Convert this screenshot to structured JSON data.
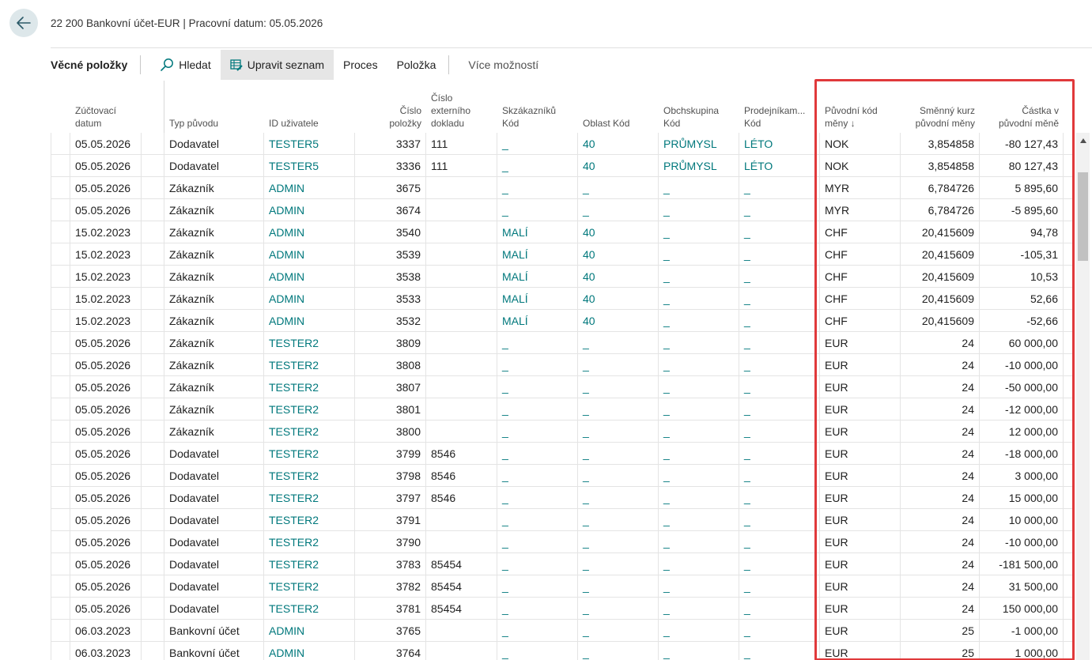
{
  "header": {
    "title": "22 200 Bankovní účet-EUR | Pracovní datum: 05.05.2026"
  },
  "action_bar": {
    "heading": "Věcné položky",
    "search": "Hledat",
    "edit_list": "Upravit seznam",
    "process": "Proces",
    "item": "Položka",
    "more": "Více možností"
  },
  "columns": {
    "posting_date": [
      "Zúčtovací",
      "datum"
    ],
    "source_type": [
      "Typ původu"
    ],
    "user_id": [
      "ID uživatele"
    ],
    "entry_no": [
      "Číslo",
      "položky"
    ],
    "ext_doc": [
      "Číslo",
      "externího",
      "dokladu"
    ],
    "cust_group": [
      "Skzákazníků",
      "Kód"
    ],
    "area_code": [
      "Oblast Kód"
    ],
    "bus_group": [
      "Obchskupina",
      "Kód"
    ],
    "salesperson": [
      "Prodejníkam...",
      "Kód"
    ],
    "orig_currency": [
      "Původní kód",
      "měny ↓"
    ],
    "exch_rate": [
      "Směnný kurz",
      "původní měny"
    ],
    "orig_amount": [
      "Částka v",
      "původní měně"
    ]
  },
  "rows": [
    {
      "date": "05.05.2026",
      "type": "Dodavatel",
      "user": "TESTER5",
      "no": "3337",
      "ext": "111",
      "cg": "_",
      "area": "40",
      "bg": "PRŮMYSL",
      "sp": "LÉTO",
      "cur": "NOK",
      "rate": "3,854858",
      "amt": "-80 127,43"
    },
    {
      "date": "05.05.2026",
      "type": "Dodavatel",
      "user": "TESTER5",
      "no": "3336",
      "ext": "111",
      "cg": "_",
      "area": "40",
      "bg": "PRŮMYSL",
      "sp": "LÉTO",
      "cur": "NOK",
      "rate": "3,854858",
      "amt": "80 127,43"
    },
    {
      "date": "05.05.2026",
      "type": "Zákazník",
      "user": "ADMIN",
      "no": "3675",
      "ext": "",
      "cg": "_",
      "area": "_",
      "bg": "_",
      "sp": "_",
      "cur": "MYR",
      "rate": "6,784726",
      "amt": "5 895,60"
    },
    {
      "date": "05.05.2026",
      "type": "Zákazník",
      "user": "ADMIN",
      "no": "3674",
      "ext": "",
      "cg": "_",
      "area": "_",
      "bg": "_",
      "sp": "_",
      "cur": "MYR",
      "rate": "6,784726",
      "amt": "-5 895,60"
    },
    {
      "date": "15.02.2023",
      "type": "Zákazník",
      "user": "ADMIN",
      "no": "3540",
      "ext": "",
      "cg": "MALÍ",
      "area": "40",
      "bg": "_",
      "sp": "_",
      "cur": "CHF",
      "rate": "20,415609",
      "amt": "94,78"
    },
    {
      "date": "15.02.2023",
      "type": "Zákazník",
      "user": "ADMIN",
      "no": "3539",
      "ext": "",
      "cg": "MALÍ",
      "area": "40",
      "bg": "_",
      "sp": "_",
      "cur": "CHF",
      "rate": "20,415609",
      "amt": "-105,31"
    },
    {
      "date": "15.02.2023",
      "type": "Zákazník",
      "user": "ADMIN",
      "no": "3538",
      "ext": "",
      "cg": "MALÍ",
      "area": "40",
      "bg": "_",
      "sp": "_",
      "cur": "CHF",
      "rate": "20,415609",
      "amt": "10,53"
    },
    {
      "date": "15.02.2023",
      "type": "Zákazník",
      "user": "ADMIN",
      "no": "3533",
      "ext": "",
      "cg": "MALÍ",
      "area": "40",
      "bg": "_",
      "sp": "_",
      "cur": "CHF",
      "rate": "20,415609",
      "amt": "52,66"
    },
    {
      "date": "15.02.2023",
      "type": "Zákazník",
      "user": "ADMIN",
      "no": "3532",
      "ext": "",
      "cg": "MALÍ",
      "area": "40",
      "bg": "_",
      "sp": "_",
      "cur": "CHF",
      "rate": "20,415609",
      "amt": "-52,66"
    },
    {
      "date": "05.05.2026",
      "type": "Zákazník",
      "user": "TESTER2",
      "no": "3809",
      "ext": "",
      "cg": "_",
      "area": "_",
      "bg": "_",
      "sp": "_",
      "cur": "EUR",
      "rate": "24",
      "amt": "60 000,00"
    },
    {
      "date": "05.05.2026",
      "type": "Zákazník",
      "user": "TESTER2",
      "no": "3808",
      "ext": "",
      "cg": "_",
      "area": "_",
      "bg": "_",
      "sp": "_",
      "cur": "EUR",
      "rate": "24",
      "amt": "-10 000,00"
    },
    {
      "date": "05.05.2026",
      "type": "Zákazník",
      "user": "TESTER2",
      "no": "3807",
      "ext": "",
      "cg": "_",
      "area": "_",
      "bg": "_",
      "sp": "_",
      "cur": "EUR",
      "rate": "24",
      "amt": "-50 000,00"
    },
    {
      "date": "05.05.2026",
      "type": "Zákazník",
      "user": "TESTER2",
      "no": "3801",
      "ext": "",
      "cg": "_",
      "area": "_",
      "bg": "_",
      "sp": "_",
      "cur": "EUR",
      "rate": "24",
      "amt": "-12 000,00"
    },
    {
      "date": "05.05.2026",
      "type": "Zákazník",
      "user": "TESTER2",
      "no": "3800",
      "ext": "",
      "cg": "_",
      "area": "_",
      "bg": "_",
      "sp": "_",
      "cur": "EUR",
      "rate": "24",
      "amt": "12 000,00"
    },
    {
      "date": "05.05.2026",
      "type": "Dodavatel",
      "user": "TESTER2",
      "no": "3799",
      "ext": "8546",
      "cg": "_",
      "area": "_",
      "bg": "_",
      "sp": "_",
      "cur": "EUR",
      "rate": "24",
      "amt": "-18 000,00"
    },
    {
      "date": "05.05.2026",
      "type": "Dodavatel",
      "user": "TESTER2",
      "no": "3798",
      "ext": "8546",
      "cg": "_",
      "area": "_",
      "bg": "_",
      "sp": "_",
      "cur": "EUR",
      "rate": "24",
      "amt": "3 000,00"
    },
    {
      "date": "05.05.2026",
      "type": "Dodavatel",
      "user": "TESTER2",
      "no": "3797",
      "ext": "8546",
      "cg": "_",
      "area": "_",
      "bg": "_",
      "sp": "_",
      "cur": "EUR",
      "rate": "24",
      "amt": "15 000,00"
    },
    {
      "date": "05.05.2026",
      "type": "Dodavatel",
      "user": "TESTER2",
      "no": "3791",
      "ext": "",
      "cg": "_",
      "area": "_",
      "bg": "_",
      "sp": "_",
      "cur": "EUR",
      "rate": "24",
      "amt": "10 000,00"
    },
    {
      "date": "05.05.2026",
      "type": "Dodavatel",
      "user": "TESTER2",
      "no": "3790",
      "ext": "",
      "cg": "_",
      "area": "_",
      "bg": "_",
      "sp": "_",
      "cur": "EUR",
      "rate": "24",
      "amt": "-10 000,00"
    },
    {
      "date": "05.05.2026",
      "type": "Dodavatel",
      "user": "TESTER2",
      "no": "3783",
      "ext": "85454",
      "cg": "_",
      "area": "_",
      "bg": "_",
      "sp": "_",
      "cur": "EUR",
      "rate": "24",
      "amt": "-181 500,00"
    },
    {
      "date": "05.05.2026",
      "type": "Dodavatel",
      "user": "TESTER2",
      "no": "3782",
      "ext": "85454",
      "cg": "_",
      "area": "_",
      "bg": "_",
      "sp": "_",
      "cur": "EUR",
      "rate": "24",
      "amt": "31 500,00"
    },
    {
      "date": "05.05.2026",
      "type": "Dodavatel",
      "user": "TESTER2",
      "no": "3781",
      "ext": "85454",
      "cg": "_",
      "area": "_",
      "bg": "_",
      "sp": "_",
      "cur": "EUR",
      "rate": "24",
      "amt": "150 000,00"
    },
    {
      "date": "06.03.2023",
      "type": "Bankovní účet",
      "user": "ADMIN",
      "no": "3765",
      "ext": "",
      "cg": "_",
      "area": "_",
      "bg": "_",
      "sp": "_",
      "cur": "EUR",
      "rate": "25",
      "amt": "-1 000,00"
    },
    {
      "date": "06.03.2023",
      "type": "Bankovní účet",
      "user": "ADMIN",
      "no": "3764",
      "ext": "",
      "cg": "_",
      "area": "_",
      "bg": "_",
      "sp": "_",
      "cur": "EUR",
      "rate": "25",
      "amt": "1 000,00"
    }
  ],
  "colors": {
    "link": "#00787c",
    "highlight_border": "#e0393b",
    "back_button_bg": "#dde7ea"
  }
}
